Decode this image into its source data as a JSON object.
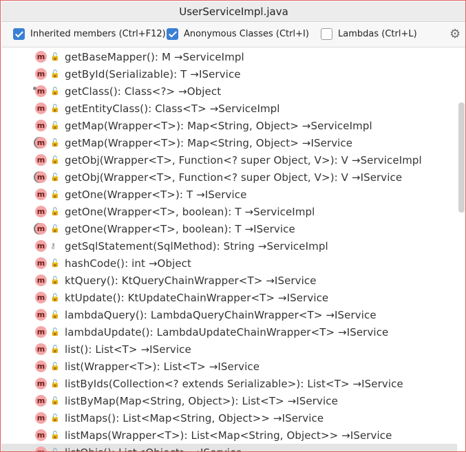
{
  "window": {
    "title": "UserServiceImpl.java"
  },
  "toolbar": {
    "inherited": {
      "label": "Inherited members (Ctrl+F12)",
      "checked": true
    },
    "anonymous": {
      "label": "Anonymous Classes (Ctrl+I)",
      "checked": true
    },
    "lambdas": {
      "label": "Lambdas (Ctrl+L)",
      "checked": false
    },
    "settings_icon": "gear-icon"
  },
  "members": [
    {
      "sig": "getBaseMapper(): M →ServiceImpl",
      "vis": "public",
      "mark": ""
    },
    {
      "sig": "getById(Serializable): T →IService",
      "vis": "public",
      "mark": ""
    },
    {
      "sig": "getClass(): Class<?> →Object",
      "vis": "public",
      "mark": "dot"
    },
    {
      "sig": "getEntityClass(): Class<T> →ServiceImpl",
      "vis": "public",
      "mark": ""
    },
    {
      "sig": "getMap(Wrapper<T>): Map<String, Object> →ServiceImpl",
      "vis": "public",
      "mark": ""
    },
    {
      "sig": "getMap(Wrapper<T>): Map<String, Object> →IService",
      "vis": "public",
      "mark": "ring"
    },
    {
      "sig": "getObj(Wrapper<T>, Function<? super Object, V>): V →ServiceImpl",
      "vis": "public",
      "mark": ""
    },
    {
      "sig": "getObj(Wrapper<T>, Function<? super Object, V>): V →IService",
      "vis": "public",
      "mark": "ring"
    },
    {
      "sig": "getOne(Wrapper<T>): T →IService",
      "vis": "public",
      "mark": ""
    },
    {
      "sig": "getOne(Wrapper<T>, boolean): T →ServiceImpl",
      "vis": "public",
      "mark": ""
    },
    {
      "sig": "getOne(Wrapper<T>, boolean): T →IService",
      "vis": "public",
      "mark": "ring"
    },
    {
      "sig": "getSqlStatement(SqlMethod): String →ServiceImpl",
      "vis": "protected",
      "mark": ""
    },
    {
      "sig": "hashCode(): int →Object",
      "vis": "public",
      "mark": ""
    },
    {
      "sig": "ktQuery(): KtQueryChainWrapper<T> →IService",
      "vis": "public",
      "mark": ""
    },
    {
      "sig": "ktUpdate(): KtUpdateChainWrapper<T> →IService",
      "vis": "public",
      "mark": ""
    },
    {
      "sig": "lambdaQuery(): LambdaQueryChainWrapper<T> →IService",
      "vis": "public",
      "mark": ""
    },
    {
      "sig": "lambdaUpdate(): LambdaUpdateChainWrapper<T> →IService",
      "vis": "public",
      "mark": ""
    },
    {
      "sig": "list(): List<T> →IService",
      "vis": "public",
      "mark": ""
    },
    {
      "sig": "list(Wrapper<T>): List<T> →IService",
      "vis": "public",
      "mark": ""
    },
    {
      "sig": "listByIds(Collection<? extends Serializable>): List<T> →IService",
      "vis": "public",
      "mark": ""
    },
    {
      "sig": "listByMap(Map<String, Object>): List<T> →IService",
      "vis": "public",
      "mark": ""
    },
    {
      "sig": "listMaps(): List<Map<String, Object>> →IService",
      "vis": "public",
      "mark": ""
    },
    {
      "sig": "listMaps(Wrapper<T>): List<Map<String, Object>> →IService",
      "vis": "public",
      "mark": ""
    },
    {
      "sig": "listObjs(): List<Object> →IService",
      "vis": "public",
      "mark": ""
    }
  ],
  "method_badge": "m",
  "colors": {
    "accent": "#3a7fd5",
    "method_badge": "#f4a6a6",
    "public_lock": "#5aa23c"
  }
}
